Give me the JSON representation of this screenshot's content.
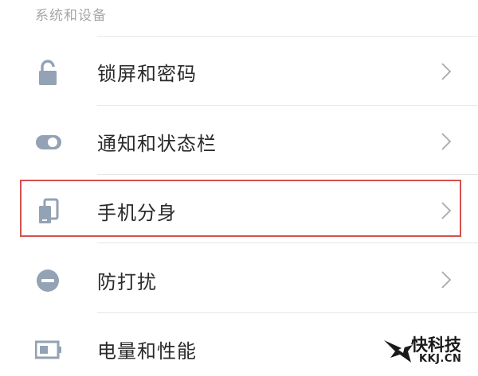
{
  "section": {
    "header": "系统和设备"
  },
  "settings_items": [
    {
      "label": "锁屏和密码",
      "icon": "lock-icon"
    },
    {
      "label": "通知和状态栏",
      "icon": "toggle-icon"
    },
    {
      "label": "手机分身",
      "icon": "second-space-icon",
      "highlighted": true
    },
    {
      "label": "防打扰",
      "icon": "do-not-disturb-icon"
    },
    {
      "label": "电量和性能",
      "icon": "battery-icon"
    }
  ],
  "colors": {
    "icon": "#93a2b4",
    "highlight_border": "#d5504f",
    "chevron": "#a9a9a9"
  },
  "watermark": {
    "title": "快科技",
    "subtitle": "KKJ.CN"
  }
}
